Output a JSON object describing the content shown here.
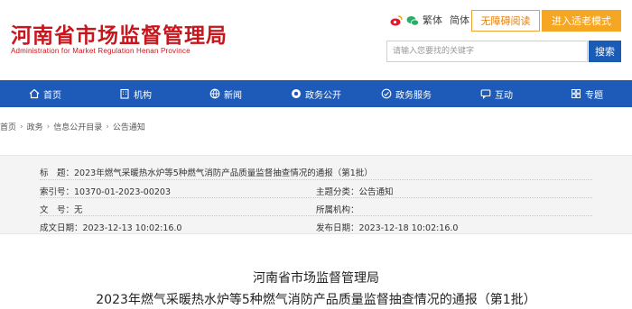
{
  "header": {
    "title_cn": "河南省市场监督管理局",
    "title_en": "Administration for Market Regulation Henan Province",
    "tools": {
      "traditional": "繁体",
      "simplified": "简体"
    },
    "accessible_btn": "无障碍阅读",
    "elder_btn": "进入适老模式",
    "search_placeholder": "请输入您要找的关键字",
    "search_btn": "搜索"
  },
  "nav": {
    "items": [
      {
        "label": "首页"
      },
      {
        "label": "机构"
      },
      {
        "label": "新闻"
      },
      {
        "label": "政务公开"
      },
      {
        "label": "政务服务"
      },
      {
        "label": "互动"
      },
      {
        "label": "专题"
      }
    ]
  },
  "breadcrumb": {
    "items": [
      "首页",
      "政务",
      "信息公开目录",
      "公告通知"
    ],
    "sep": "›"
  },
  "info": {
    "title_label": "标　题：",
    "title_value": "2023年燃气采暖热水炉等5种燃气消防产品质量监督抽查情况的通报（第1批）",
    "index_label": "索引号：",
    "index_value": "10370-01-2023-00203",
    "category_label": "主题分类：",
    "category_value": "公告通知",
    "doc_label": "文　号：",
    "doc_value": "无",
    "org_label": "所属机构：",
    "org_value": "",
    "created_label": "成文日期：",
    "created_value": "2023-12-13 10:02:16.0",
    "published_label": "发布日期：",
    "published_value": "2023-12-18 10:02:16.0"
  },
  "article": {
    "org": "河南省市场监督管理局",
    "title": "2023年燃气采暖热水炉等5种燃气消防产品质量监督抽查情况的通报（第1批）"
  },
  "colors": {
    "brand_red": "#c8161d",
    "nav_blue": "#1e5bb8",
    "elder_orange": "#f5a623"
  }
}
